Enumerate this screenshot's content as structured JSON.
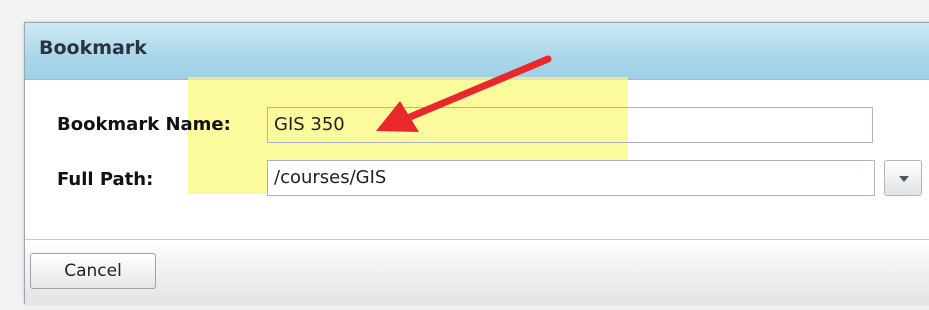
{
  "dialog": {
    "title": "Bookmark"
  },
  "form": {
    "name_label": "Bookmark Name:",
    "name_value": "GIS 350",
    "path_label": "Full Path:",
    "path_value": "/courses/GIS"
  },
  "footer": {
    "cancel_label": "Cancel"
  },
  "colors": {
    "highlight": "#fafa78",
    "arrow": "#e8282a",
    "title_bar": "#a9d7ea"
  },
  "icons": {
    "dropdown": "chevron-down-icon",
    "annotation": "red-arrow-icon"
  }
}
